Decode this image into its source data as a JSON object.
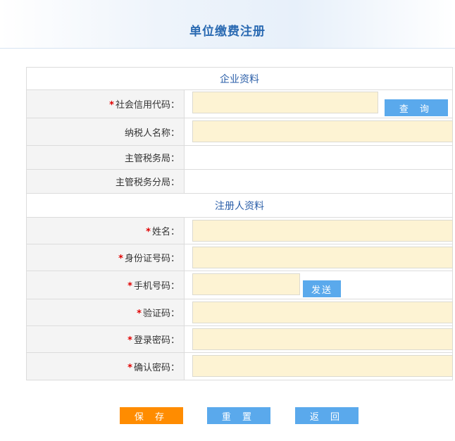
{
  "page": {
    "title": "单位缴费注册"
  },
  "sections": {
    "company": "企业资料",
    "registrant": "注册人资料"
  },
  "required_mark": "*",
  "fields": {
    "credit_code": {
      "label": "社会信用代码：",
      "value": "",
      "placeholder": ""
    },
    "query_button": "查 询",
    "taxpayer_name": {
      "label": "纳税人名称：",
      "value": ""
    },
    "tax_bureau": {
      "label": "主管税务局：",
      "value": ""
    },
    "tax_sub_bureau": {
      "label": "主管税务分局：",
      "value": ""
    },
    "name": {
      "label": "姓名：",
      "value": ""
    },
    "id_number": {
      "label": "身份证号码：",
      "value": ""
    },
    "phone": {
      "label": "手机号码：",
      "value": ""
    },
    "send_button": "发送",
    "verify_code": {
      "label": "验证码：",
      "value": ""
    },
    "login_password": {
      "label": "登录密码：",
      "value": ""
    },
    "confirm_password": {
      "label": "确认密码：",
      "value": ""
    }
  },
  "actions": {
    "save": "保 存",
    "reset": "重 置",
    "back": "返 回"
  },
  "colors": {
    "title": "#2a6ab2",
    "section": "#2a5ea8",
    "input_bg": "#fdf3d3",
    "blue_button": "#5aa9ec",
    "orange_button": "#ff8c00",
    "required": "#e00000"
  }
}
